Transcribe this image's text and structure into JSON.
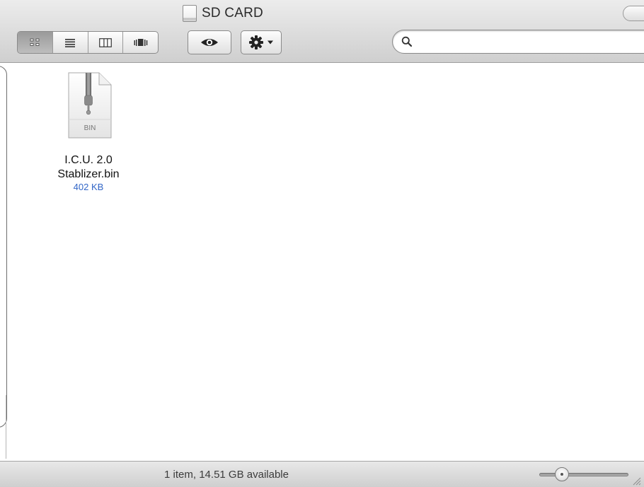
{
  "window": {
    "title": "SD CARD"
  },
  "toolbar": {
    "view_modes": [
      "icon-view",
      "list-view",
      "column-view",
      "cover-flow-view"
    ],
    "active_view": 0,
    "search": {
      "value": "",
      "placeholder": ""
    }
  },
  "files": [
    {
      "name_line1": "I.C.U. 2.0",
      "name_line2": "Stablizer.bin",
      "size": "402 KB",
      "badge": "BIN"
    }
  ],
  "status": {
    "text": "1 item, 14.51 GB available"
  },
  "icon_size_slider": {
    "value": 0.25
  },
  "colors": {
    "size_text": "#3266c7",
    "toolbar_top": "#ececec",
    "toolbar_bottom": "#cfcfcf"
  }
}
